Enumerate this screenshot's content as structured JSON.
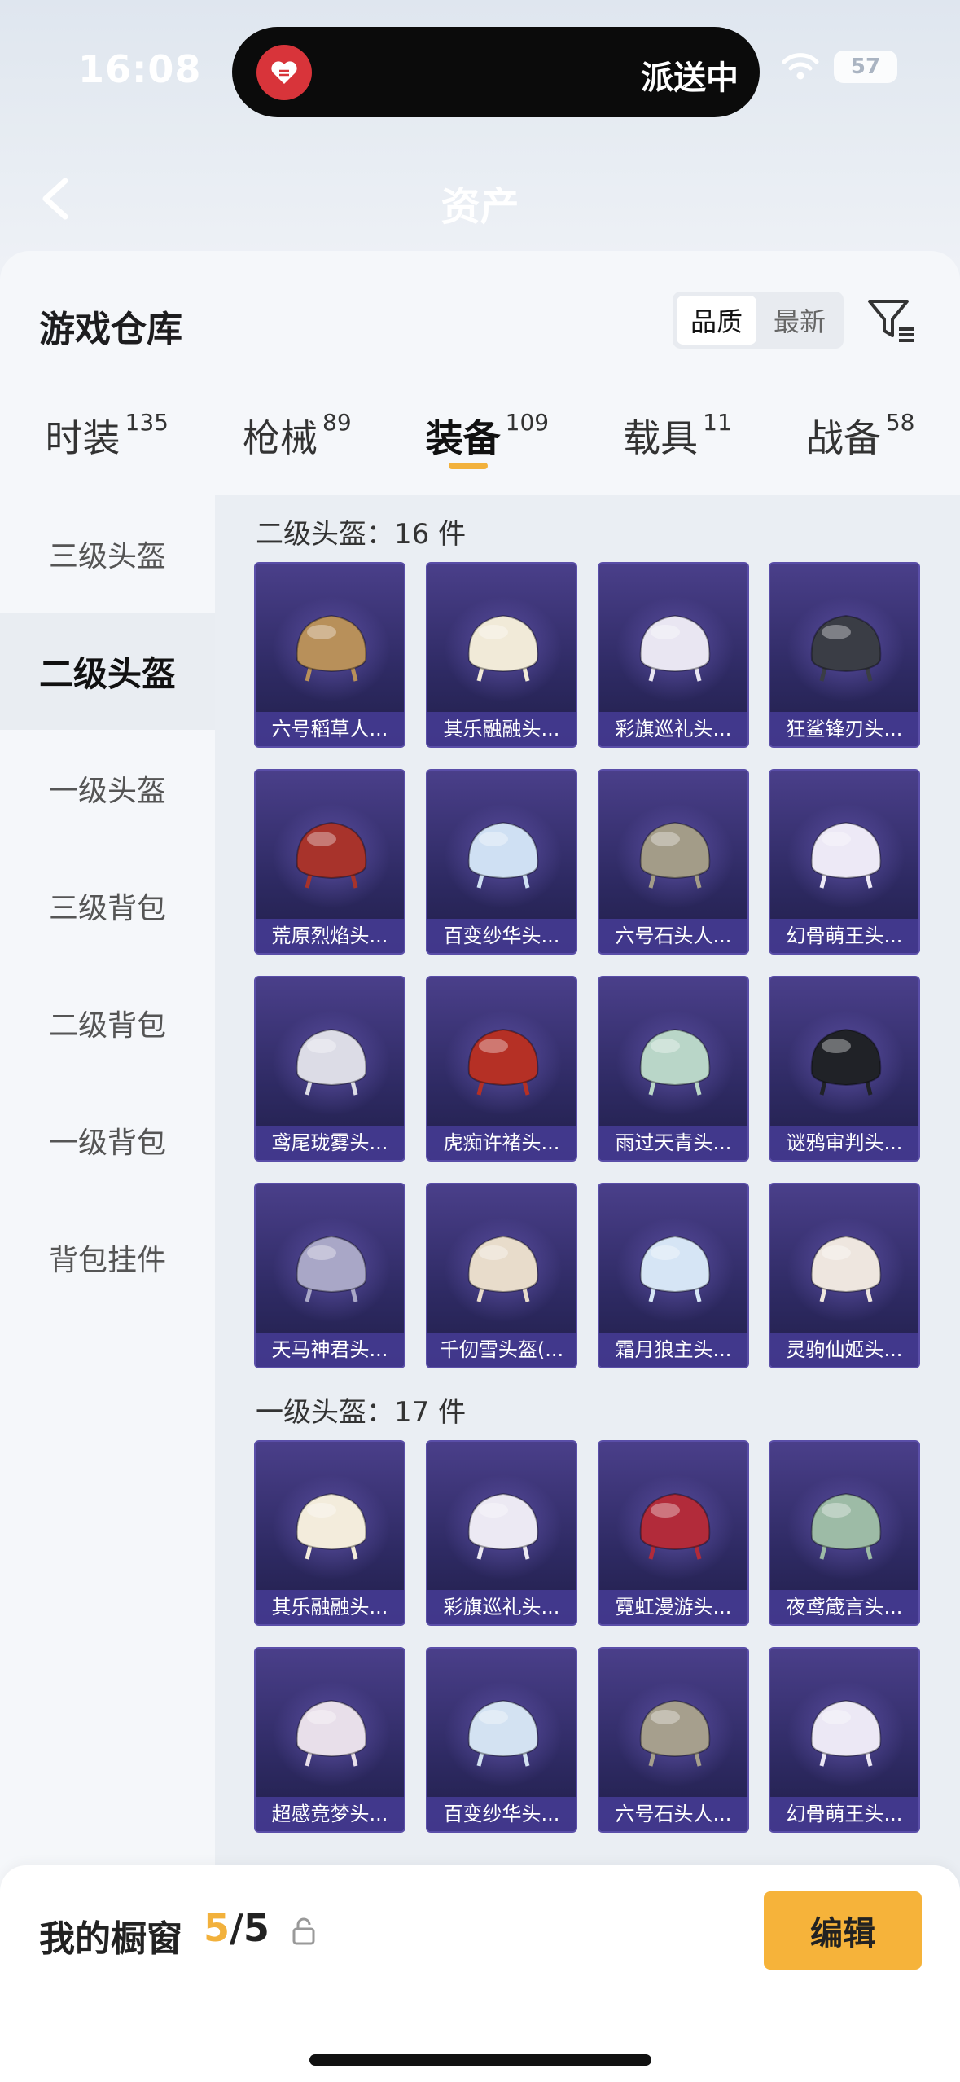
{
  "status_bar": {
    "time": "16:08",
    "island_text": "派送中",
    "battery": "57"
  },
  "header": {
    "title": "资产"
  },
  "panel": {
    "title": "游戏仓库",
    "sort_options": [
      "品质",
      "最新"
    ],
    "active_sort": "品质"
  },
  "tabs": [
    {
      "label": "时装",
      "count": "135"
    },
    {
      "label": "枪械",
      "count": "89"
    },
    {
      "label": "装备",
      "count": "109",
      "active": true
    },
    {
      "label": "载具",
      "count": "11"
    },
    {
      "label": "战备",
      "count": "58"
    }
  ],
  "sidebar": {
    "items": [
      "三级头盔",
      "二级头盔",
      "一级头盔",
      "三级背包",
      "二级背包",
      "一级背包",
      "背包挂件"
    ],
    "active": "二级头盔"
  },
  "sections": [
    {
      "title": "二级头盔：16 件",
      "items": [
        {
          "name": "六号稻草人...",
          "color": "#b8905a"
        },
        {
          "name": "其乐融融头...",
          "color": "#f1ead8"
        },
        {
          "name": "彩旗巡礼头...",
          "color": "#e9e6f2"
        },
        {
          "name": "狂鲨锋刃头...",
          "color": "#3a3d45"
        },
        {
          "name": "荒原烈焰头...",
          "color": "#a8332b"
        },
        {
          "name": "百变纱华头...",
          "color": "#cfe0f3"
        },
        {
          "name": "六号石头人...",
          "color": "#a39c88"
        },
        {
          "name": "幻骨萌王头...",
          "color": "#ede9f6"
        },
        {
          "name": "鸢尾珑雾头...",
          "color": "#dcdce6"
        },
        {
          "name": "虎痴许褚头...",
          "color": "#b53025"
        },
        {
          "name": "雨过天青头...",
          "color": "#b9d6c8"
        },
        {
          "name": "谜鸦审判头...",
          "color": "#202227"
        },
        {
          "name": "天马神君头...",
          "color": "#a9a7c7"
        },
        {
          "name": "千仞雪头盔(...",
          "color": "#e8dccb"
        },
        {
          "name": "霜月狼主头...",
          "color": "#d6e5f5"
        },
        {
          "name": "灵驹仙姬头...",
          "color": "#eee6df"
        }
      ]
    },
    {
      "title": "一级头盔：17 件",
      "items": [
        {
          "name": "其乐融融头...",
          "color": "#f3ecdc"
        },
        {
          "name": "彩旗巡礼头...",
          "color": "#ece9f3"
        },
        {
          "name": "霓虹漫游头...",
          "color": "#b22b3a"
        },
        {
          "name": "夜鸢箴言头...",
          "color": "#9dbba6"
        },
        {
          "name": "超感竞梦头...",
          "color": "#e8dfea"
        },
        {
          "name": "百变纱华头...",
          "color": "#d3e2f2"
        },
        {
          "name": "六号石头人...",
          "color": "#a69f8d"
        },
        {
          "name": "幻骨萌王头...",
          "color": "#ece8f5"
        }
      ]
    }
  ],
  "bottom_bar": {
    "label": "我的橱窗",
    "current": "5",
    "total": "/5",
    "edit_label": "编辑"
  },
  "colors": {
    "accent": "#f6b33a",
    "card_bg": "#3a3480"
  }
}
